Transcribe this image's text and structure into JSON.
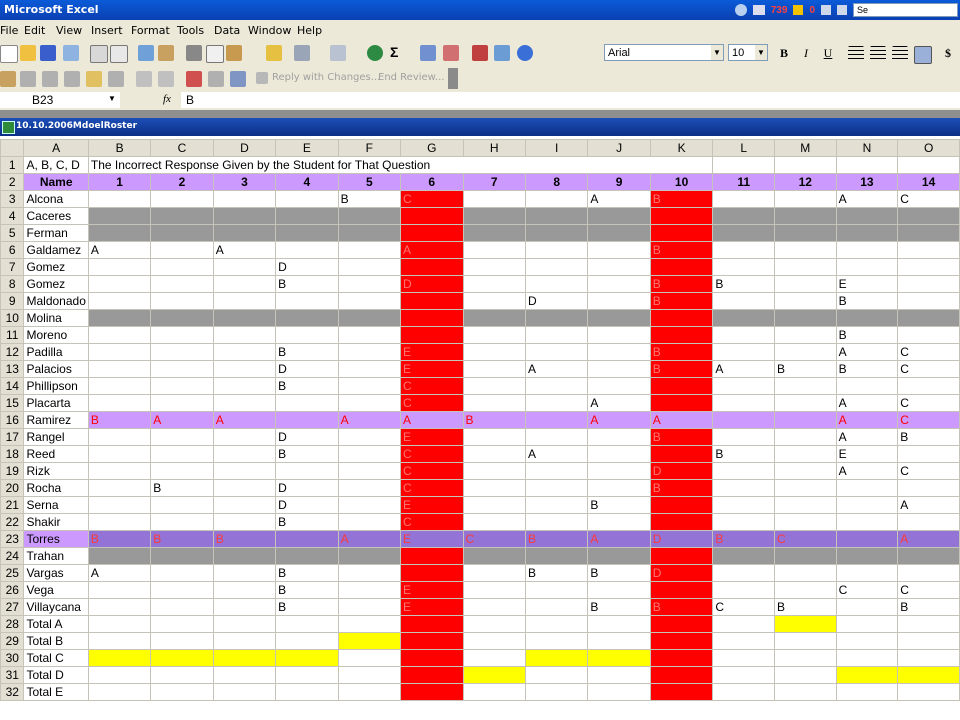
{
  "window": {
    "title": "Microsoft Excel",
    "tray_a": "739",
    "tray_b": "0",
    "search_placeholder": "Se"
  },
  "menu": [
    "File",
    "Edit",
    "View",
    "Insert",
    "Format",
    "Tools",
    "Data",
    "Window",
    "Help"
  ],
  "toolbar": {
    "font": "Arial",
    "size": "10",
    "bold": "B",
    "italic": "I",
    "underline": "U",
    "currency": "$",
    "sigma": "Σ"
  },
  "review": {
    "reply": "Reply with Changes...",
    "end": "End Review..."
  },
  "formula": {
    "name_box": "B23",
    "fx": "fx",
    "value": "B"
  },
  "workbook": {
    "title": "10.10.2006MdoelRoster"
  },
  "columns": [
    "A",
    "B",
    "C",
    "D",
    "E",
    "F",
    "G",
    "H",
    "I",
    "J",
    "K",
    "L",
    "M",
    "N",
    "O"
  ],
  "rows": [
    {
      "n": "1",
      "cells": [
        "A, B, C, D",
        "The Incorrect Response Given by the Student for That Question",
        "",
        "",
        "",
        "",
        "",
        "",
        "",
        "",
        "",
        "",
        "",
        "",
        ""
      ]
    },
    {
      "n": "2",
      "cells": [
        "Name",
        "1",
        "2",
        "3",
        "4",
        "5",
        "6",
        "7",
        "8",
        "9",
        "10",
        "11",
        "12",
        "13",
        "14"
      ]
    },
    {
      "n": "3",
      "cells": [
        "Alcona",
        "",
        "",
        "",
        "",
        "B",
        "C",
        "",
        "",
        "A",
        "B",
        "",
        "",
        "A",
        "C"
      ]
    },
    {
      "n": "4",
      "cells": [
        "Caceres",
        "",
        "",
        "",
        "",
        "",
        "",
        "",
        "",
        "",
        "",
        "",
        "",
        "",
        ""
      ]
    },
    {
      "n": "5",
      "cells": [
        "Ferman",
        "",
        "",
        "",
        "",
        "",
        "",
        "",
        "",
        "",
        "",
        "",
        "",
        "",
        ""
      ]
    },
    {
      "n": "6",
      "cells": [
        "Galdamez",
        "A",
        "",
        "A",
        "",
        "",
        "A",
        "",
        "",
        "",
        "B",
        "",
        "",
        "",
        ""
      ]
    },
    {
      "n": "7",
      "cells": [
        "Gomez",
        "",
        "",
        "",
        "D",
        "",
        "",
        "",
        "",
        "",
        "",
        "",
        "",
        "",
        ""
      ]
    },
    {
      "n": "8",
      "cells": [
        "Gomez",
        "",
        "",
        "",
        "B",
        "",
        "D",
        "",
        "",
        "",
        "B",
        "B",
        "",
        "E",
        ""
      ]
    },
    {
      "n": "9",
      "cells": [
        "Maldonado",
        "",
        "",
        "",
        "",
        "",
        "",
        "",
        "D",
        "",
        "B",
        "",
        "",
        "B",
        ""
      ]
    },
    {
      "n": "10",
      "cells": [
        "Molina",
        "",
        "",
        "",
        "",
        "",
        "",
        "",
        "",
        "",
        "",
        "",
        "",
        "",
        ""
      ]
    },
    {
      "n": "11",
      "cells": [
        "Moreno",
        "",
        "",
        "",
        "",
        "",
        "",
        "",
        "",
        "",
        "",
        "",
        "",
        "B",
        ""
      ]
    },
    {
      "n": "12",
      "cells": [
        "Padilla",
        "",
        "",
        "",
        "B",
        "",
        "E",
        "",
        "",
        "",
        "B",
        "",
        "",
        "A",
        "C"
      ]
    },
    {
      "n": "13",
      "cells": [
        "Palacios",
        "",
        "",
        "",
        "D",
        "",
        "E",
        "",
        "A",
        "",
        "B",
        "A",
        "B",
        "B",
        "C"
      ]
    },
    {
      "n": "14",
      "cells": [
        "Phillipson",
        "",
        "",
        "",
        "B",
        "",
        "C",
        "",
        "",
        "",
        "",
        "",
        "",
        "",
        ""
      ]
    },
    {
      "n": "15",
      "cells": [
        "Placarta",
        "",
        "",
        "",
        "",
        "",
        "C",
        "",
        "",
        "A",
        "",
        "",
        "",
        "A",
        "C"
      ]
    },
    {
      "n": "16",
      "cells": [
        "Ramirez",
        "B",
        "A",
        "A",
        "",
        "A",
        "A",
        "B",
        "",
        "A",
        "A",
        "",
        "",
        "A",
        "C"
      ]
    },
    {
      "n": "17",
      "cells": [
        "Rangel",
        "",
        "",
        "",
        "D",
        "",
        "E",
        "",
        "",
        "",
        "B",
        "",
        "",
        "A",
        "B"
      ]
    },
    {
      "n": "18",
      "cells": [
        "Reed",
        "",
        "",
        "",
        "B",
        "",
        "C",
        "",
        "A",
        "",
        "",
        "B",
        "",
        "E",
        ""
      ]
    },
    {
      "n": "19",
      "cells": [
        "Rizk",
        "",
        "",
        "",
        "",
        "",
        "C",
        "",
        "",
        "",
        "D",
        "",
        "",
        "A",
        "C"
      ]
    },
    {
      "n": "20",
      "cells": [
        "Rocha",
        "",
        "B",
        "",
        "D",
        "",
        "C",
        "",
        "",
        "",
        "B",
        "",
        "",
        "",
        ""
      ]
    },
    {
      "n": "21",
      "cells": [
        "Serna",
        "",
        "",
        "",
        "D",
        "",
        "E",
        "",
        "",
        "B",
        "",
        "",
        "",
        "",
        "A"
      ]
    },
    {
      "n": "22",
      "cells": [
        "Shakir",
        "",
        "",
        "",
        "B",
        "",
        "C",
        "",
        "",
        "",
        "",
        "",
        "",
        "",
        ""
      ]
    },
    {
      "n": "23",
      "cells": [
        "Torres",
        "B",
        "B",
        "B",
        "",
        "A",
        "E",
        "C",
        "B",
        "A",
        "D",
        "B",
        "C",
        "",
        "A"
      ]
    },
    {
      "n": "24",
      "cells": [
        "Trahan",
        "",
        "",
        "",
        "",
        "",
        "",
        "",
        "",
        "",
        "",
        "",
        "",
        "",
        ""
      ]
    },
    {
      "n": "25",
      "cells": [
        "Vargas",
        "A",
        "",
        "",
        "B",
        "",
        "",
        "",
        "B",
        "B",
        "D",
        "",
        "",
        "",
        ""
      ]
    },
    {
      "n": "26",
      "cells": [
        "Vega",
        "",
        "",
        "",
        "B",
        "",
        "E",
        "",
        "",
        "",
        "",
        "",
        "",
        "C",
        "C"
      ]
    },
    {
      "n": "27",
      "cells": [
        "Villaycana",
        "",
        "",
        "",
        "B",
        "",
        "E",
        "",
        "",
        "B",
        "B",
        "C",
        "B",
        "",
        "B"
      ]
    },
    {
      "n": "28",
      "cells": [
        "Total A",
        "",
        "",
        "",
        "",
        "",
        "",
        "",
        "",
        "",
        "",
        "",
        "",
        "",
        ""
      ]
    },
    {
      "n": "29",
      "cells": [
        "Total B",
        "",
        "",
        "",
        "",
        "",
        "",
        "",
        "",
        "",
        "",
        "",
        "",
        "",
        ""
      ]
    },
    {
      "n": "30",
      "cells": [
        "Total C",
        "",
        "",
        "",
        "",
        "",
        "",
        "",
        "",
        "",
        "",
        "",
        "",
        "",
        ""
      ]
    },
    {
      "n": "31",
      "cells": [
        "Total D",
        "",
        "",
        "",
        "",
        "",
        "",
        "",
        "",
        "",
        "",
        "",
        "",
        "",
        ""
      ]
    },
    {
      "n": "32",
      "cells": [
        "Total E",
        "",
        "",
        "",
        "",
        "",
        "",
        "",
        "",
        "",
        "",
        "",
        "",
        "",
        ""
      ]
    }
  ]
}
